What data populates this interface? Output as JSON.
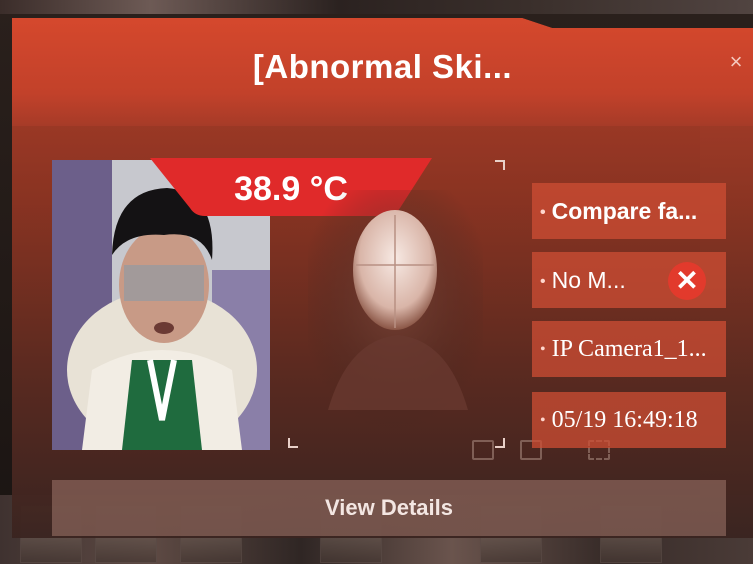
{
  "popup": {
    "title": "[Abnormal Ski...",
    "close_label": "×"
  },
  "temperature": {
    "value": "38.9 °C",
    "banner_color": "#e02a2a"
  },
  "info": {
    "items": [
      {
        "text": "Compare fa..."
      },
      {
        "text": "No M..."
      },
      {
        "text": "IP Camera1_1..."
      },
      {
        "text": "05/19 16:49:18"
      }
    ],
    "bullet": "•",
    "fail_icon_glyph": "✕"
  },
  "actions": {
    "view_details_label": "View Details"
  },
  "colors": {
    "header": "#c9442c",
    "alarm_red": "#e23a2c"
  }
}
